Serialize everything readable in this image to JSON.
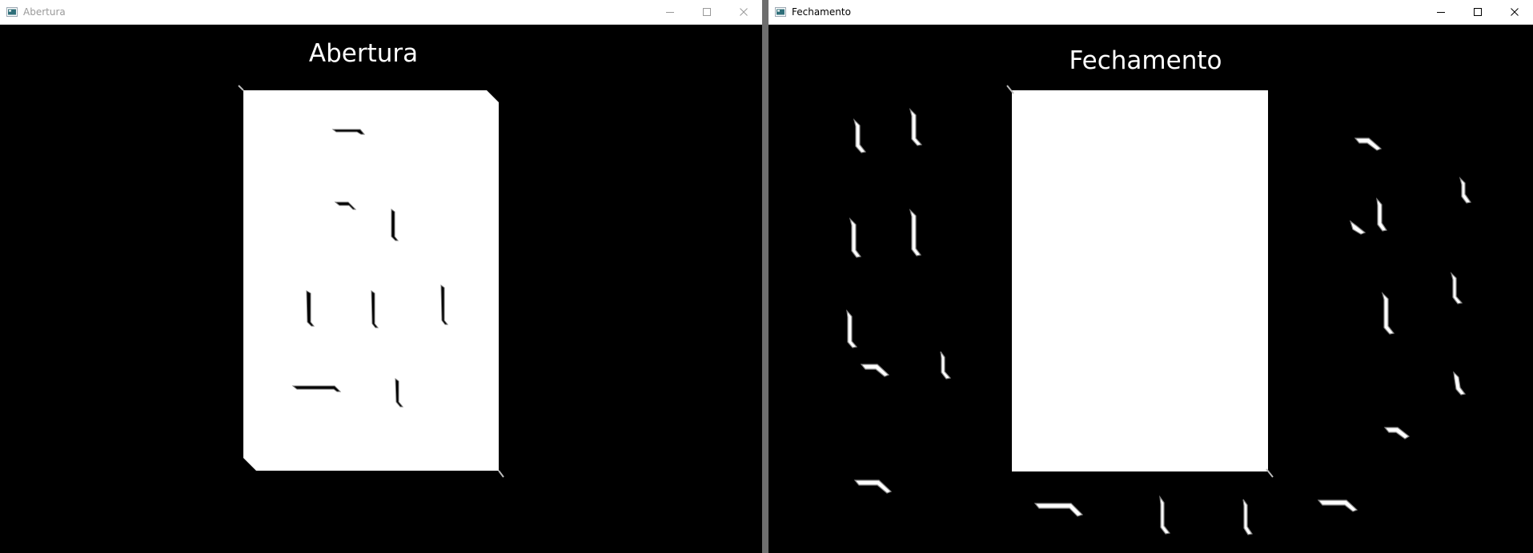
{
  "windows": [
    {
      "title": "Abertura",
      "image_title": "Abertura",
      "icon": "opencv-window-icon",
      "active": false
    },
    {
      "title": "Fechamento",
      "image_title": "Fechamento",
      "icon": "opencv-window-icon",
      "active": true
    }
  ],
  "controls": [
    "minimize-icon",
    "maximize-icon",
    "close-icon"
  ]
}
